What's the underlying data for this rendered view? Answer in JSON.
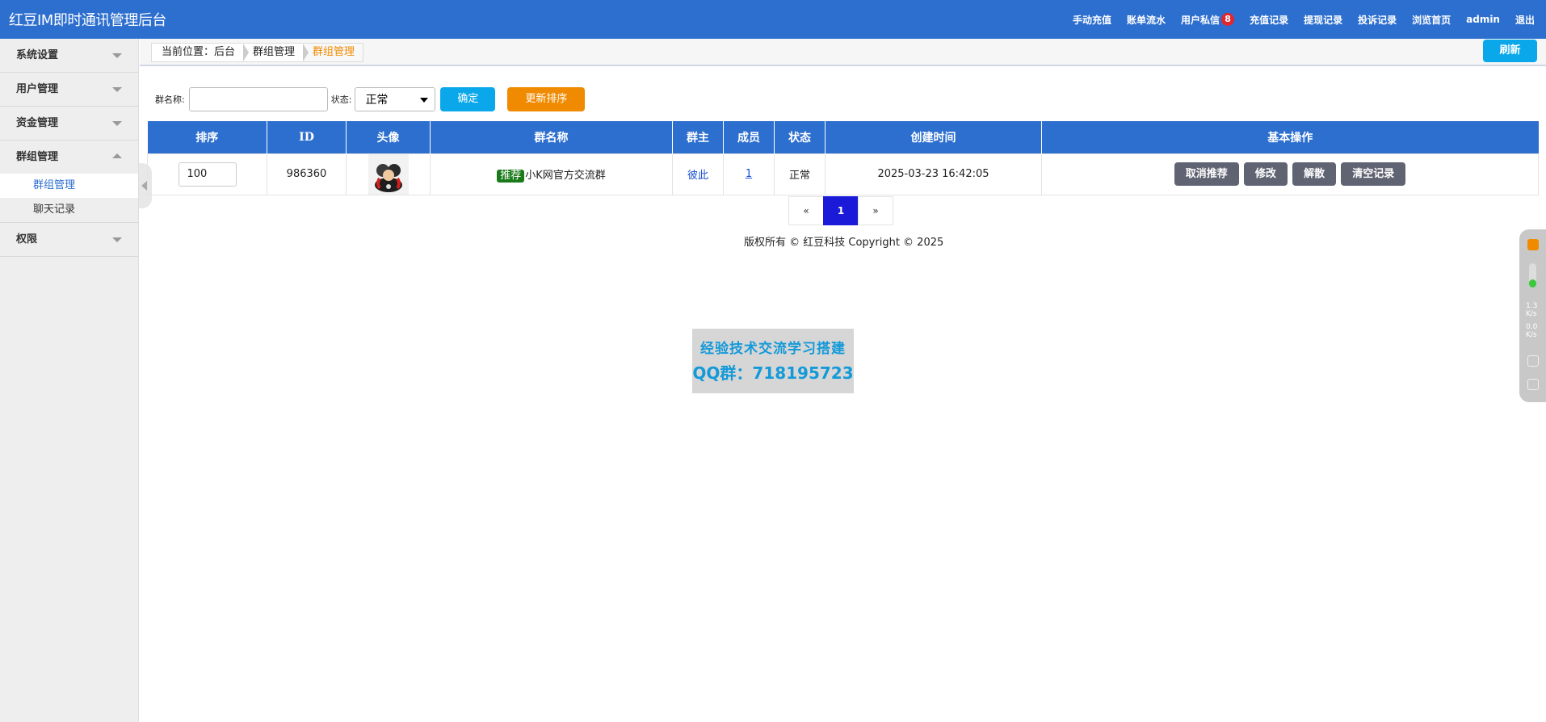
{
  "app": {
    "title": "红豆IM即时通讯管理后台"
  },
  "topnav": [
    {
      "label": "手动充值"
    },
    {
      "label": "账单流水"
    },
    {
      "label": "用户私信",
      "badge": "8"
    },
    {
      "label": "充值记录"
    },
    {
      "label": "提现记录"
    },
    {
      "label": "投诉记录"
    },
    {
      "label": "浏览首页"
    },
    {
      "label": "admin"
    },
    {
      "label": "退出"
    }
  ],
  "sidebar": {
    "groups": [
      {
        "label": "系统设置"
      },
      {
        "label": "用户管理"
      },
      {
        "label": "资金管理"
      },
      {
        "label": "群组管理",
        "items": [
          {
            "label": "群组管理"
          },
          {
            "label": "聊天记录"
          }
        ]
      },
      {
        "label": "权限"
      }
    ]
  },
  "breadcrumb": [
    "当前位置：后台",
    "群组管理",
    "群组管理"
  ],
  "refresh_label": "刷新",
  "search": {
    "name_label": "群名称:",
    "name_value": "",
    "status_label": "状态:",
    "status_value": "正常",
    "confirm_label": "确定",
    "sort_label": "更新排序"
  },
  "table": {
    "headers": [
      "排序",
      "ID",
      "头像",
      "群名称",
      "群主",
      "成员",
      "状态",
      "创建时间",
      "基本操作"
    ],
    "rows": [
      {
        "sort": "100",
        "id": "986360",
        "tag": "推荐",
        "name": "小K网官方交流群",
        "owner": "彼此",
        "members": "1",
        "status": "正常",
        "created": "2025-03-23 16:42:05",
        "actions": [
          "取消推荐",
          "修改",
          "解散",
          "清空记录"
        ]
      }
    ]
  },
  "pager": {
    "prev": "«",
    "current": "1",
    "next": "»"
  },
  "copyright": "版权所有 © 红豆科技 Copyright © 2025",
  "watermark": {
    "line1": "经验技术交流学习搭建",
    "line2": "QQ群：718195723"
  },
  "widget": {
    "up_speed": "1.3",
    "down_speed": "0.0",
    "unit": "K/s"
  },
  "colors": {
    "primary": "#2d6fcf",
    "accent": "#0aa8ea",
    "orange": "#f08a00",
    "badge": "#e3262e"
  }
}
